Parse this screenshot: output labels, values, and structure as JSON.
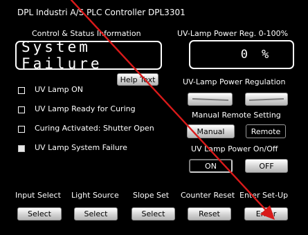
{
  "title": "DPL Industri A/S PLC Controller DPL3301",
  "control_status": {
    "heading": "Control & Status Information",
    "display_text": "System Failure",
    "help_label": "Help Text"
  },
  "uv_power_reg": {
    "heading": "UV-Lamp Power Reg. 0-100%",
    "value": "0",
    "unit": "%"
  },
  "status_items": [
    {
      "label": "UV Lamp ON",
      "checked": false
    },
    {
      "label": "UV Lamp Ready for Curing",
      "checked": false
    },
    {
      "label": "Curing Activated: Shutter Open",
      "checked": false
    },
    {
      "label": "UV Lamp System Failure",
      "checked": true
    }
  ],
  "power_regulation": {
    "heading": "UV-Lamp Power Regulation"
  },
  "manual_remote": {
    "heading": "Manual Remote Setting",
    "manual_label": "Manual",
    "remote_label": "Remote"
  },
  "power_onoff": {
    "heading": "UV Lamp Power On/Off",
    "on_label": "ON",
    "off_label": "OFF"
  },
  "bottom_labels": [
    "Input Select",
    "Light Source",
    "Slope Set",
    "Counter Reset",
    "Enter Set-Up"
  ],
  "bottom_buttons": [
    "Select",
    "Select",
    "Select",
    "Reset",
    "Enter"
  ],
  "colors": {
    "background": "#000000",
    "text": "#ffffff",
    "annotation_arrow": "#d91a1a"
  }
}
